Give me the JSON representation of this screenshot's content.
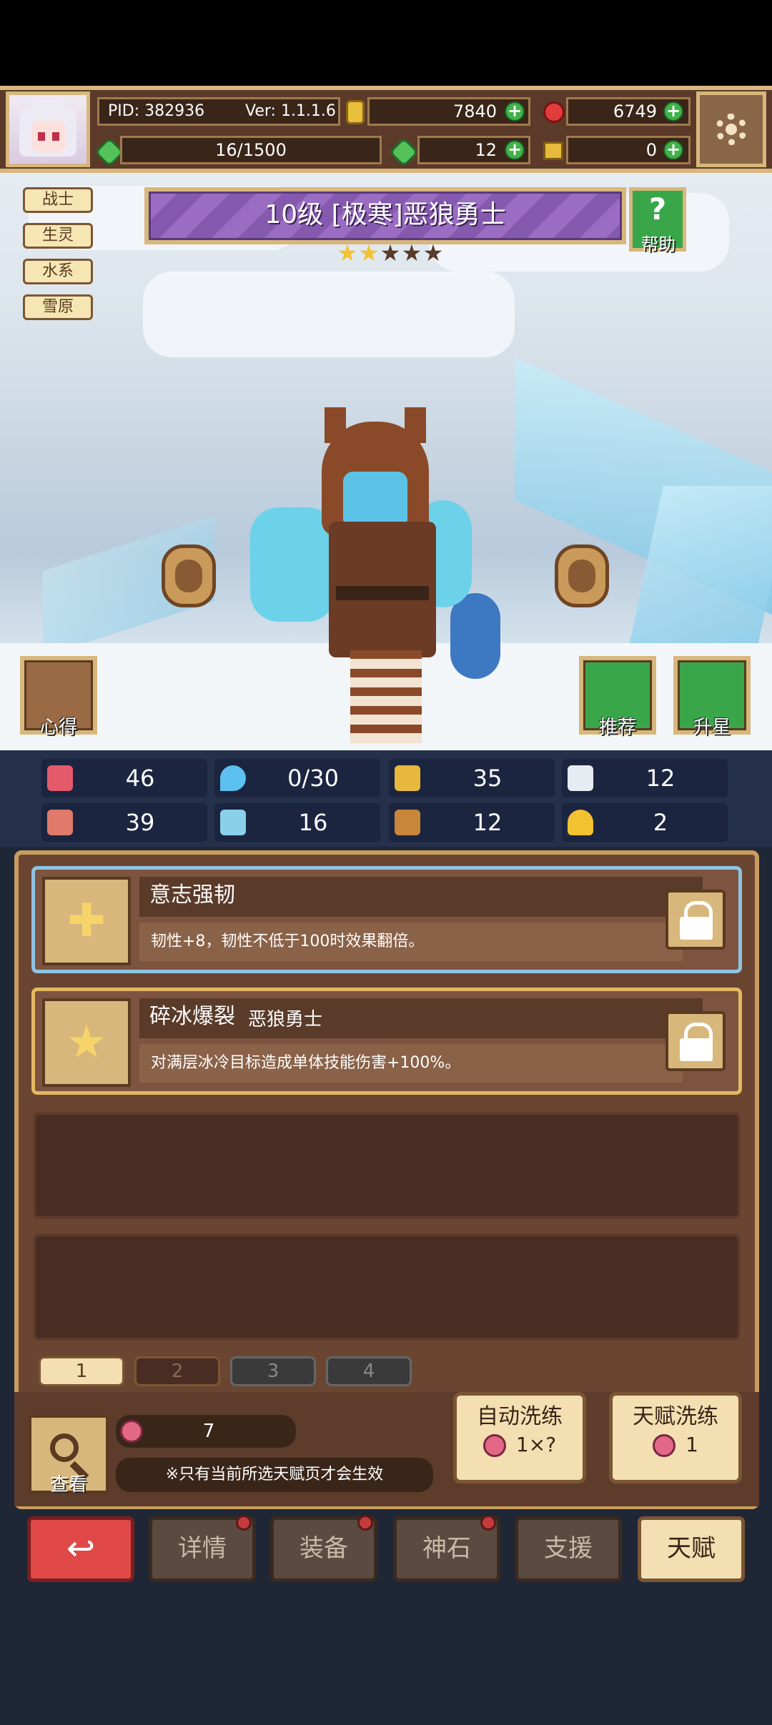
{
  "header": {
    "pid": "PID: 382936",
    "version": "Ver: 1.1.1.6",
    "gold": "7840",
    "gems": "6749",
    "stamina": "16/1500",
    "clover": "12",
    "keys": "0"
  },
  "tags": [
    "战士",
    "生灵",
    "水系",
    "雪原"
  ],
  "hero": {
    "title": "10级  [极寒]恶狼勇士",
    "stars_filled": 2,
    "stars_total": 5,
    "help_label": "帮助"
  },
  "side_buttons": {
    "notes": "心得",
    "recommend": "推荐",
    "upgrade": "升星"
  },
  "stats": [
    {
      "icon": "heart-icon",
      "value": "46"
    },
    {
      "icon": "water-drop-icon",
      "value": "0/30"
    },
    {
      "icon": "shield-icon",
      "value": "35"
    },
    {
      "icon": "wing-icon",
      "value": "12"
    },
    {
      "icon": "fist-icon",
      "value": "39"
    },
    {
      "icon": "book-icon",
      "value": "16"
    },
    {
      "icon": "scroll-icon",
      "value": "12"
    },
    {
      "icon": "horseshoe-icon",
      "value": "2"
    }
  ],
  "talents": [
    {
      "name": "意志强韧",
      "source": "",
      "desc": "韧性+8，韧性不低于100时效果翻倍。"
    },
    {
      "name": "碎冰爆裂",
      "source": "恶狼勇士",
      "desc": "对满层冰冷目标造成单体技能伤害+100%。"
    }
  ],
  "pages": [
    "1",
    "2",
    "3",
    "4"
  ],
  "footer": {
    "look_label": "查看",
    "fruit_count": "7",
    "note": "※只有当前所选天赋页才会生效",
    "auto_wash_label": "自动洗练",
    "auto_wash_cost": "1×?",
    "talent_wash_label": "天赋洗练",
    "talent_wash_cost": "1"
  },
  "nav": {
    "details": "详情",
    "equipment": "装备",
    "godstone": "神石",
    "support": "支援",
    "talent": "天赋"
  },
  "colors": {
    "panel": "#6a4632",
    "gold_trim": "#d8b77c",
    "title_purple": "#9a6cc2",
    "back_red": "#e04848",
    "active_nav": "#f3dfb1"
  }
}
